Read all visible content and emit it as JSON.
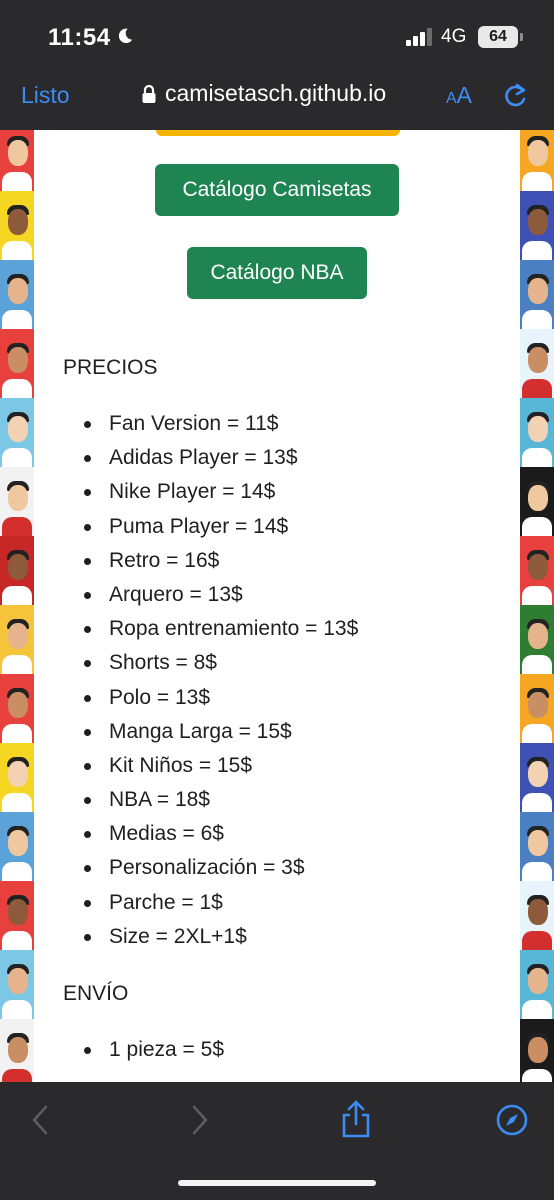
{
  "status_bar": {
    "time": "11:54",
    "network": "4G",
    "battery": "64"
  },
  "browser": {
    "done_label": "Listo",
    "url": "camisetasch.github.io",
    "text_size_small": "A",
    "text_size_big": "A"
  },
  "buttons": {
    "camisetas": "Catálogo Camisetas",
    "nba": "Catálogo NBA"
  },
  "prices": {
    "heading": "PRECIOS",
    "items": [
      "Fan Version = 11$",
      "Adidas Player = 13$",
      "Nike Player = 14$",
      "Puma Player = 14$",
      "Retro = 16$",
      "Arquero = 13$",
      "Ropa entrenamiento = 13$",
      "Shorts = 8$",
      "Polo = 13$",
      "Manga Larga = 15$",
      "Kit Niños = 15$",
      "NBA = 18$",
      "Medias = 6$",
      "Personalización = 3$",
      "Parche = 1$",
      "Size = 2XL+1$"
    ]
  },
  "shipping": {
    "heading": "ENVÍO",
    "items": [
      "1 pieza = 5$"
    ]
  },
  "colors": {
    "accent_blue": "#3d8cf5",
    "button_green": "#1e8552",
    "button_yellow": "#f4b400",
    "bar_bg": "#2a2a2c"
  },
  "icons": {
    "moon": "moon-icon",
    "lock": "lock-icon",
    "reload": "reload-icon",
    "back": "chevron-left-icon",
    "forward": "chevron-right-icon",
    "share": "share-icon",
    "compass": "compass-icon"
  }
}
